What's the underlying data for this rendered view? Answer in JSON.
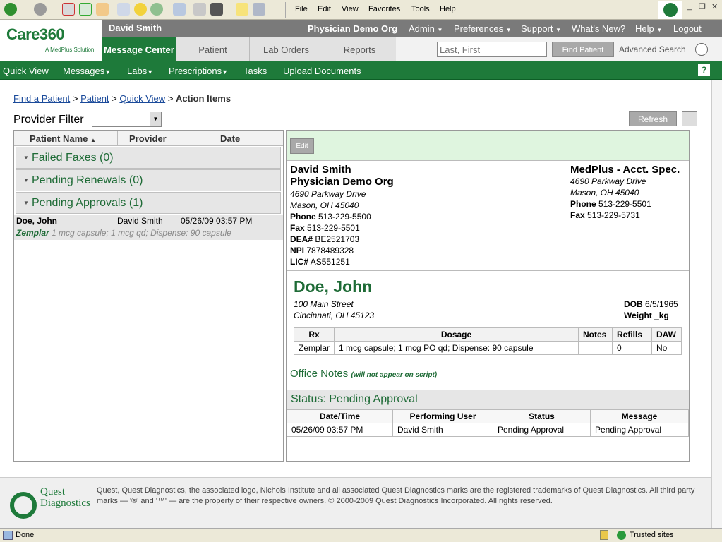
{
  "browser": {
    "menu": [
      "File",
      "Edit",
      "View",
      "Favorites",
      "Tools",
      "Help"
    ],
    "status": "Done",
    "zone": "Trusted sites"
  },
  "header": {
    "logo_main": "Care360",
    "logo_sub": "A MedPlus Solution",
    "user": "David Smith",
    "org": "Physician Demo Org",
    "top_menu": [
      "Admin",
      "Preferences",
      "Support",
      "What's New?",
      "Help",
      "Logout"
    ],
    "tabs": [
      "Message Center",
      "Patient",
      "Lab Orders",
      "Reports"
    ],
    "search_placeholder": "Last, First",
    "find_patient": "Find Patient",
    "advanced_search": "Advanced Search"
  },
  "nav": [
    "Quick View",
    "Messages",
    "Labs",
    "Prescriptions",
    "Tasks",
    "Upload Documents"
  ],
  "breadcrumb": {
    "b1": "Find a Patient",
    "b2": "Patient",
    "b3": "Quick View",
    "current": "Action Items",
    "sep": ">"
  },
  "filter": {
    "label": "Provider Filter",
    "refresh": "Refresh"
  },
  "left_panel": {
    "columns": [
      "Patient Name",
      "Provider",
      "Date"
    ],
    "groups": [
      "Failed Faxes (0)",
      "Pending Renewals (0)",
      "Pending Approvals (1)"
    ],
    "item": {
      "patient": "Doe, John",
      "provider": "David Smith",
      "date": "05/26/09 03:57 PM",
      "drug": "Zemplar",
      "detail": "1 mcg capsule; 1 mcg qd; Dispense: 90 capsule"
    }
  },
  "detail": {
    "edit": "Edit",
    "prescriber": {
      "name": "David Smith",
      "org": "Physician Demo Org",
      "addr1": "4690 Parkway Drive",
      "addr2": "Mason, OH  45040",
      "phone_label": "Phone",
      "phone": "513-229-5500",
      "fax_label": "Fax",
      "fax": "513-229-5501",
      "dea_label": "DEA#",
      "dea": "BE2521703",
      "npi_label": "NPI",
      "npi": "7878489328",
      "lic_label": "LIC#",
      "lic": "AS551251"
    },
    "pharmacy": {
      "name": "MedPlus - Acct. Spec.",
      "addr1": "4690 Parkway Drive",
      "addr2": "Mason, OH  45040",
      "phone_label": "Phone",
      "phone": "513-229-5501",
      "fax_label": "Fax",
      "fax": "513-229-5731"
    },
    "patient": {
      "name": "Doe, John",
      "addr1": "100 Main Street",
      "addr2": "Cincinnati, OH  45123",
      "dob_label": "DOB",
      "dob": "6/5/1965",
      "weight": "Weight _kg"
    },
    "rx_headers": [
      "Rx",
      "Dosage",
      "Notes",
      "Refills",
      "DAW"
    ],
    "rx_row": [
      "Zemplar",
      "1 mcg capsule; 1 mcg PO qd; Dispense: 90 capsule",
      "",
      "0",
      "No"
    ],
    "office_notes": "Office Notes",
    "office_notes_note": "(will not appear on script)",
    "status_title": "Status: Pending Approval",
    "status_headers": [
      "Date/Time",
      "Performing User",
      "Status",
      "Message"
    ],
    "status_row": [
      "05/26/09 03:57 PM",
      "David Smith",
      "Pending Approval",
      "Pending Approval"
    ]
  },
  "footer": {
    "brand1": "Quest",
    "brand2": "Diagnostics",
    "legal": "Quest, Quest Diagnostics, the associated logo, Nichols Institute and all associated Quest Diagnostics marks are the registered trademarks of Quest Diagnostics. All third party marks — '®' and '™' — are the property of their respective owners. © 2000-2009 Quest Diagnostics Incorporated. All rights reserved."
  }
}
